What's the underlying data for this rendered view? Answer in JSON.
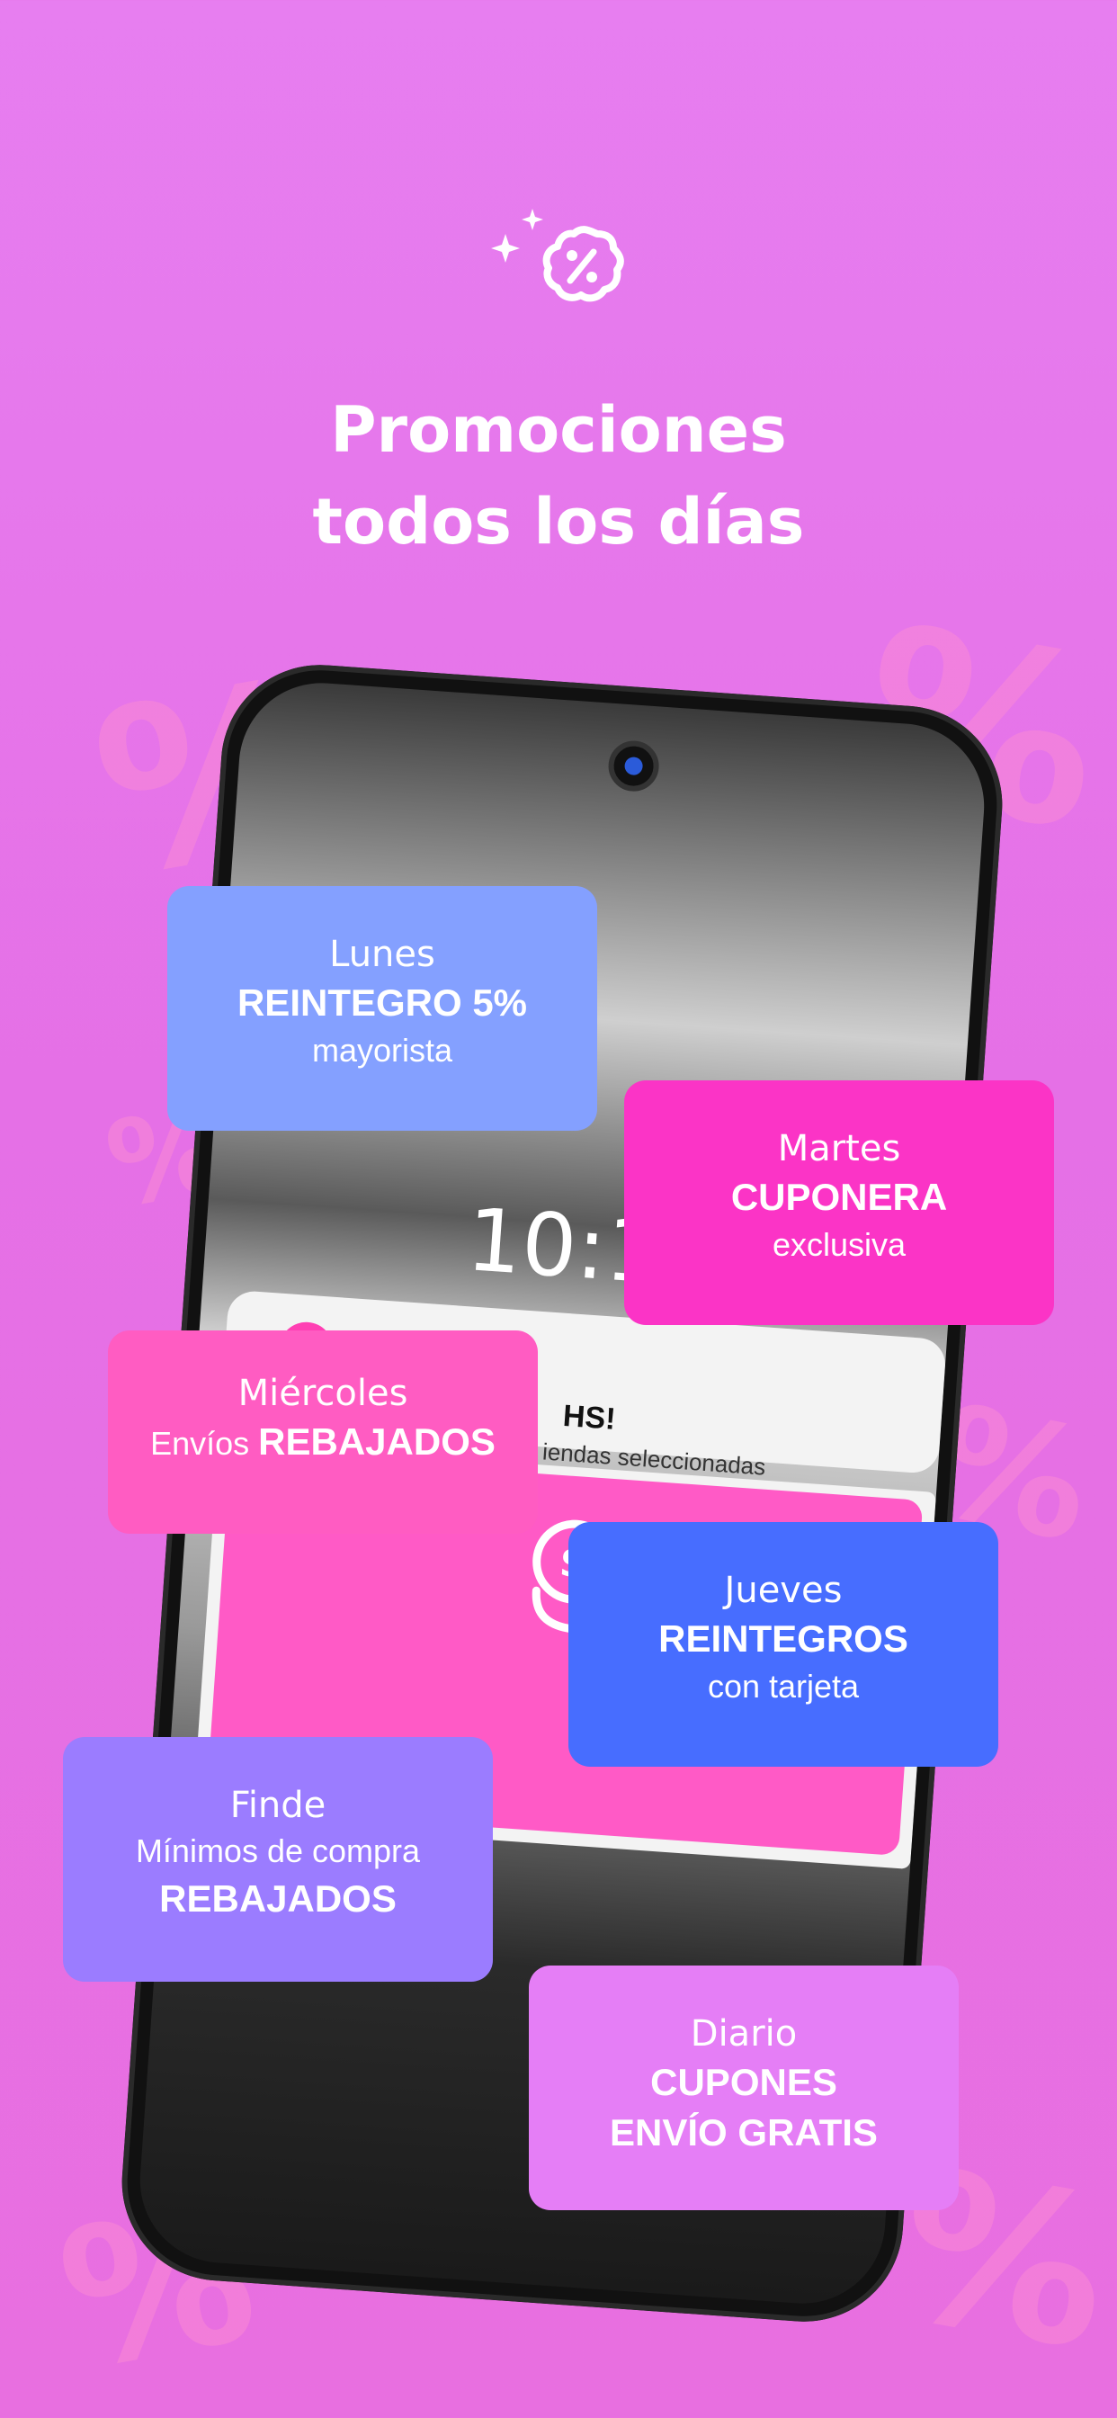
{
  "header": {
    "title_line1": "Promociones",
    "title_line2": "todos los días",
    "icon": "discount-badge-icon"
  },
  "phone": {
    "clock": "10:1",
    "notification": {
      "title": "HS!",
      "subtitle": "iendas seleccionadas"
    },
    "promo_icon": "piggy-bank-dollar-icon"
  },
  "cards": {
    "lunes": {
      "day": "Lunes",
      "highlight": "REINTEGRO 5%",
      "detail": "mayorista",
      "color": "#84a0ff"
    },
    "martes": {
      "day": "Martes",
      "highlight": "CUPONERA",
      "detail": "exclusiva",
      "color": "#fb34c6"
    },
    "miercoles": {
      "day": "Miércoles",
      "prefix": "Envíos",
      "highlight": "REBAJADOS",
      "color": "#ff5cc2"
    },
    "jueves": {
      "day": "Jueves",
      "highlight": "REINTEGROS",
      "detail": "con tarjeta",
      "color": "#476dff"
    },
    "finde": {
      "day": "Finde",
      "detail": "Mínimos de compra",
      "highlight": "REBAJADOS",
      "color": "#9b7cff"
    },
    "diario": {
      "day": "Diario",
      "highlight_line1": "CUPONES",
      "highlight_line2": "ENVÍO GRATIS",
      "color": "#e57ef6"
    }
  },
  "colors": {
    "background": "#e77ef0",
    "text": "#ffffff"
  }
}
